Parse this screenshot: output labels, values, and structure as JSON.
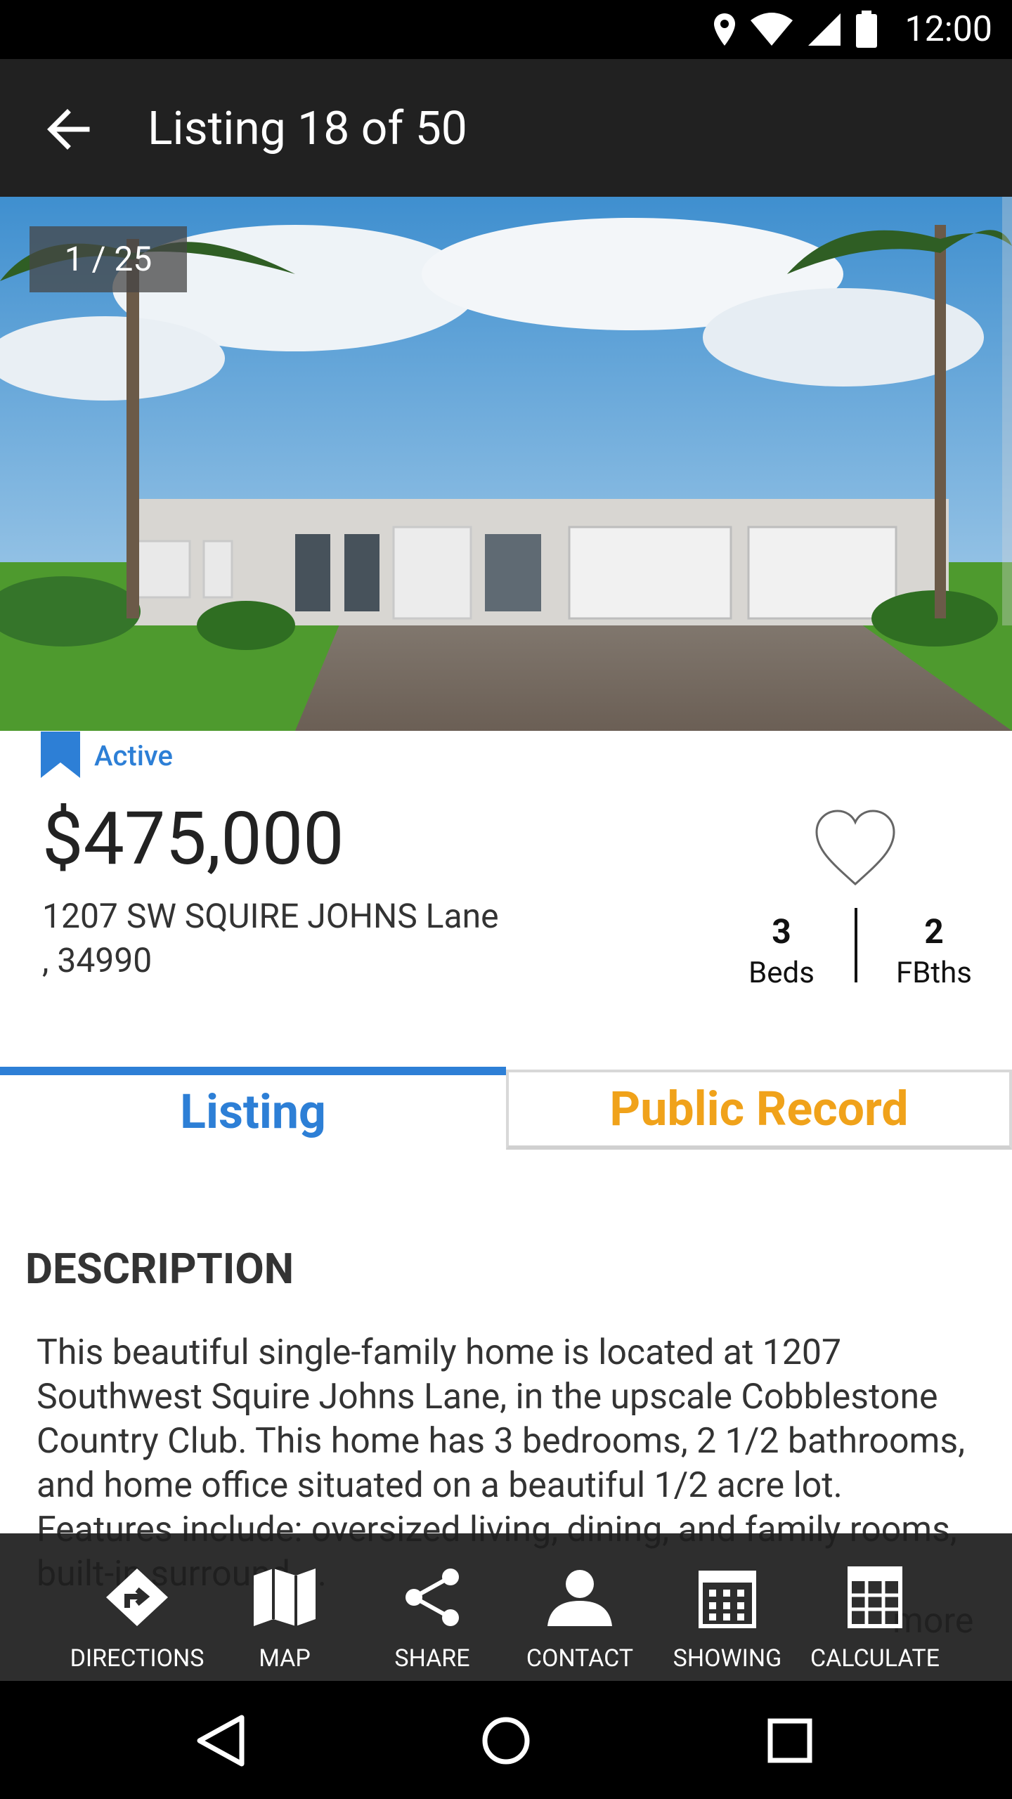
{
  "status_bar": {
    "time": "12:00",
    "icons": [
      "location-icon",
      "wifi-icon",
      "signal-icon",
      "battery-icon"
    ]
  },
  "app_bar": {
    "title": "Listing 18 of 50",
    "back_icon": "arrow-back-icon"
  },
  "gallery": {
    "counter": "1 / 25"
  },
  "listing": {
    "status": "Active",
    "price": "$475,000",
    "address_line1": "1207 SW SQUIRE JOHNS Lane",
    "address_line2": ", 34990",
    "beds_value": "3",
    "beds_label": "Beds",
    "baths_value": "2",
    "baths_label": "FBths"
  },
  "tabs": {
    "listing": "Listing",
    "public_record": "Public Record"
  },
  "description": {
    "title": "DESCRIPTION",
    "body": "This beautiful single-family home is located at 1207 Southwest Squire Johns Lane, in the upscale Cobblestone Country Club. This home has 3 bedrooms, 2 1/2 bathrooms, and home office situated on a beautiful 1/2 acre lot. Features include: oversized living, dining, and family rooms, built-in surround ...",
    "more": "more"
  },
  "actions": [
    {
      "label": "DIRECTIONS",
      "icon": "directions-icon"
    },
    {
      "label": "MAP",
      "icon": "map-icon"
    },
    {
      "label": "SHARE",
      "icon": "share-icon"
    },
    {
      "label": "CONTACT",
      "icon": "contact-icon"
    },
    {
      "label": "SHOWING",
      "icon": "calendar-icon"
    },
    {
      "label": "CALCULATE",
      "icon": "calculator-icon"
    }
  ],
  "colors": {
    "accent_blue": "#2d7fd6",
    "accent_orange": "#f0a21a",
    "app_bar": "#212121"
  }
}
